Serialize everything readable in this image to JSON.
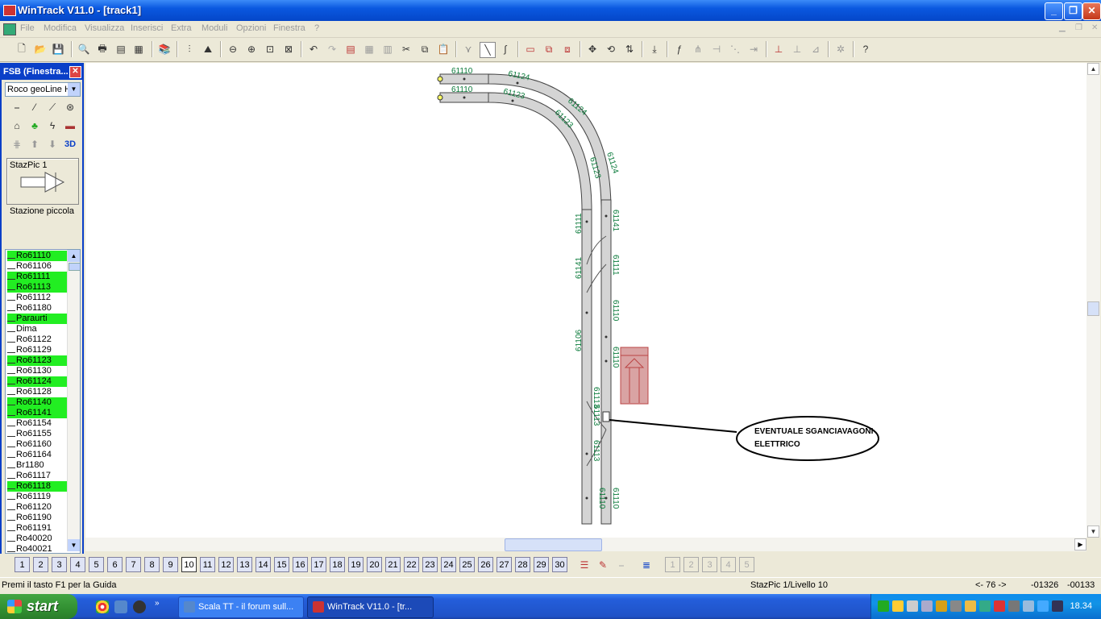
{
  "window": {
    "title": "WinTrack  V11.0 - [track1]",
    "min": "_",
    "max": "❐",
    "close": "✕"
  },
  "menu": [
    "File",
    "Modifica",
    "Visualizza",
    "Inserisci",
    "Extra",
    "Moduli",
    "Opzioni",
    "Finestra",
    "?"
  ],
  "panel": {
    "title": "FSB (Finestra...",
    "close": "✕",
    "manufacturer": "Roco geoLine H",
    "item_label": "StazPic 1",
    "item_caption": "Stazione piccola",
    "icon_3d": "3D"
  },
  "articles": [
    {
      "label": "Ro61110",
      "selected": true
    },
    {
      "label": "Ro61106",
      "selected": false
    },
    {
      "label": "Ro61111",
      "selected": true
    },
    {
      "label": "Ro61113",
      "selected": true
    },
    {
      "label": "Ro61112",
      "selected": false
    },
    {
      "label": "Ro61180",
      "selected": false
    },
    {
      "label": "Paraurti",
      "selected": true
    },
    {
      "label": "Dima",
      "selected": false
    },
    {
      "label": "Ro61122",
      "selected": false
    },
    {
      "label": "Ro61129",
      "selected": false
    },
    {
      "label": "Ro61123",
      "selected": true
    },
    {
      "label": "Ro61130",
      "selected": false
    },
    {
      "label": "Ro61124",
      "selected": true
    },
    {
      "label": "Ro61128",
      "selected": false
    },
    {
      "label": "Ro61140",
      "selected": true
    },
    {
      "label": "Ro61141",
      "selected": true
    },
    {
      "label": "Ro61154",
      "selected": false
    },
    {
      "label": "Ro61155",
      "selected": false
    },
    {
      "label": "Ro61160",
      "selected": false
    },
    {
      "label": "Ro61164",
      "selected": false
    },
    {
      "label": "Br1180",
      "selected": false
    },
    {
      "label": "Ro61117",
      "selected": false
    },
    {
      "label": "Ro61118",
      "selected": true
    },
    {
      "label": "Ro61119",
      "selected": false
    },
    {
      "label": "Ro61120",
      "selected": false
    },
    {
      "label": "Ro61190",
      "selected": false
    },
    {
      "label": "Ro61191",
      "selected": false
    },
    {
      "label": "Ro40020",
      "selected": false
    },
    {
      "label": "Ro40021",
      "selected": false
    }
  ],
  "track_labels": {
    "top1": "61110",
    "top2": "61110",
    "arc_outer_1": "61124",
    "arc_inner_1": "61123",
    "arc_outer_2": "61124",
    "arc_inner_2": "61123",
    "arc_outer_3": "61124",
    "arc_inner_3": "61123",
    "left_1": "61111",
    "left_2": "61141",
    "left_3": "61106",
    "right_1": "61141",
    "right_2": "61111",
    "right_3": "61110",
    "right_4": "61110",
    "sw_1": "61113",
    "sw_2": "61113",
    "sw_3": "61113",
    "bottom_left": "61110",
    "bottom_right": "61110"
  },
  "annotation": {
    "line1": "EVENTUALE SGANCIAVAGONI",
    "line2": "ELETTRICO"
  },
  "levels": [
    "1",
    "2",
    "3",
    "4",
    "5",
    "6",
    "7",
    "8",
    "9",
    "10",
    "11",
    "12",
    "13",
    "14",
    "15",
    "16",
    "17",
    "18",
    "19",
    "20",
    "21",
    "22",
    "23",
    "24",
    "25",
    "26",
    "27",
    "28",
    "29",
    "30"
  ],
  "layer_tabs": [
    "1",
    "2",
    "3",
    "4",
    "5"
  ],
  "status": {
    "help": "Premi il tasto F1 per la Guida",
    "station": "StazPic 1/Livello 10",
    "angle": "<- 76 ->",
    "x": "-01326",
    "y": "-00133"
  },
  "taskbar": {
    "start": "start",
    "tasks": [
      "Scala TT - il forum sull...",
      "WinTrack  V11.0 - [tr..."
    ],
    "clock": "18.34"
  },
  "colors": {
    "selected": "#22ee22",
    "track_label": "#0a7a3a",
    "title_blue": "#0a58e0"
  }
}
